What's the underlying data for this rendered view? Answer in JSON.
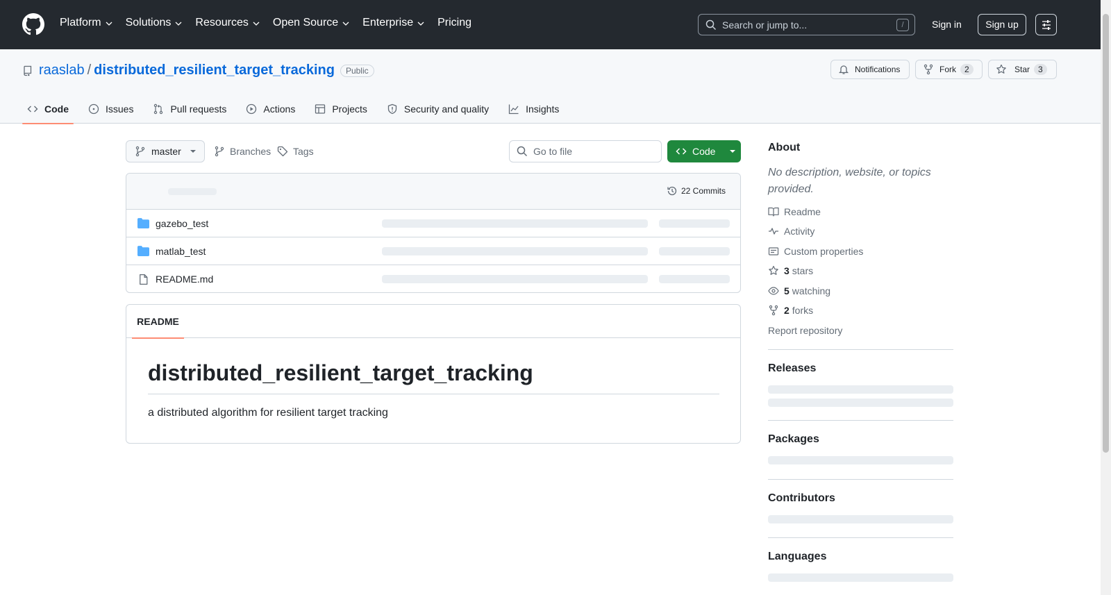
{
  "header": {
    "nav": [
      {
        "label": "Platform",
        "dropdown": true
      },
      {
        "label": "Solutions",
        "dropdown": true
      },
      {
        "label": "Resources",
        "dropdown": true
      },
      {
        "label": "Open Source",
        "dropdown": true
      },
      {
        "label": "Enterprise",
        "dropdown": true
      },
      {
        "label": "Pricing",
        "dropdown": false
      }
    ],
    "search_placeholder": "Search or jump to...",
    "search_shortcut": "/",
    "signin": "Sign in",
    "signup": "Sign up"
  },
  "repo": {
    "owner": "raaslab",
    "separator": "/",
    "name": "distributed_resilient_target_tracking",
    "visibility": "Public",
    "notifications_label": "Notifications",
    "fork_label": "Fork",
    "fork_count": "2",
    "star_label": "Star",
    "star_count": "3"
  },
  "tabs": [
    {
      "label": "Code",
      "icon": "code-icon"
    },
    {
      "label": "Issues",
      "icon": "issue-icon"
    },
    {
      "label": "Pull requests",
      "icon": "pull-request-icon"
    },
    {
      "label": "Actions",
      "icon": "play-icon"
    },
    {
      "label": "Projects",
      "icon": "table-icon"
    },
    {
      "label": "Security and quality",
      "icon": "shield-icon"
    },
    {
      "label": "Insights",
      "icon": "graph-icon"
    }
  ],
  "toolbar": {
    "branch": "master",
    "branches": "Branches",
    "tags": "Tags",
    "goto_placeholder": "Go to file",
    "code_button": "Code"
  },
  "files": {
    "commits": "22 Commits",
    "rows": [
      {
        "name": "gazebo_test",
        "type": "folder"
      },
      {
        "name": "matlab_test",
        "type": "folder"
      },
      {
        "name": "README.md",
        "type": "file"
      }
    ]
  },
  "readme": {
    "tab": "README",
    "heading": "distributed_resilient_target_tracking",
    "body": "a distributed algorithm for resilient target tracking"
  },
  "sidebar": {
    "about_heading": "About",
    "about_desc": "No description, website, or topics provided.",
    "readme": "Readme",
    "activity": "Activity",
    "custom_properties": "Custom properties",
    "stars_count": "3",
    "stars_label": "stars",
    "watching_count": "5",
    "watching_label": "watching",
    "forks_count": "2",
    "forks_label": "forks",
    "report": "Report repository",
    "releases": "Releases",
    "packages": "Packages",
    "contributors": "Contributors",
    "languages": "Languages"
  },
  "colors": {
    "topbar": "#24292f",
    "link": "#0969da",
    "primary_button": "#1f883d",
    "tab_underline": "#fd8c73",
    "folder": "#54aeff"
  }
}
